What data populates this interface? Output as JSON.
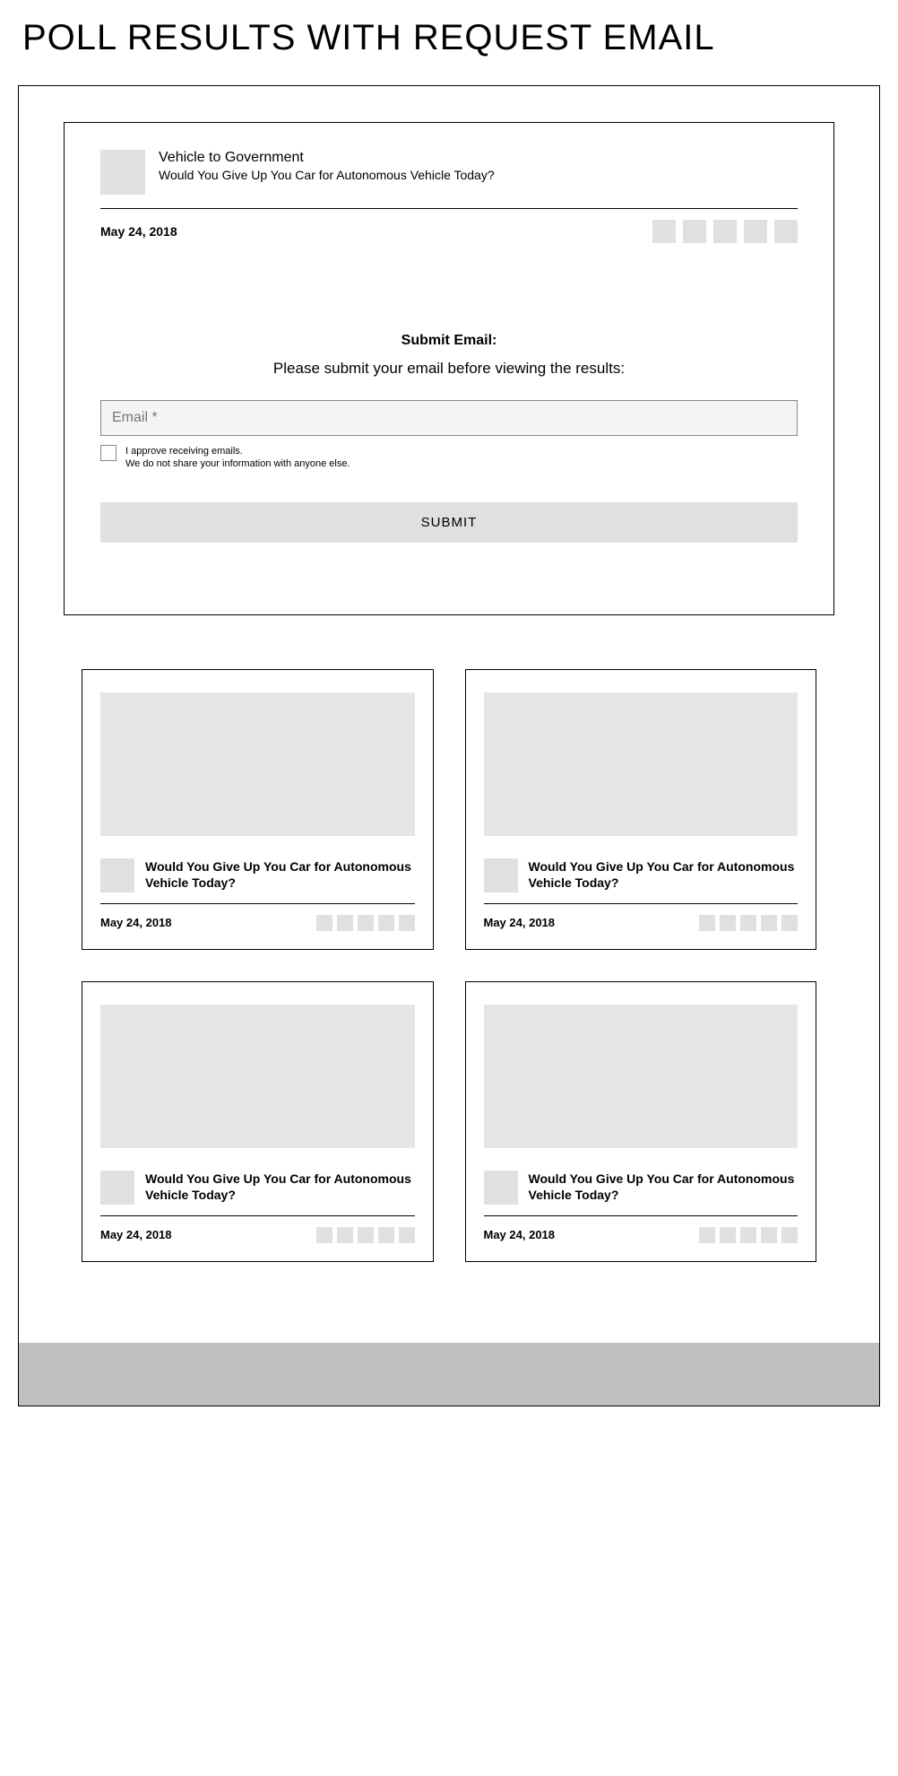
{
  "page_title": "POLL RESULTS WITH REQUEST EMAIL",
  "main": {
    "site_name": "Vehicle to Government",
    "question": "Would You Give Up You Car for Autonomous Vehicle Today?",
    "date": "May 24, 2018",
    "email": {
      "heading": "Submit Email:",
      "description": "Please submit your email before viewing the results:",
      "placeholder": "Email *",
      "consent_line1": "I approve receiving emails.",
      "consent_line2": "We do not share your information with anyone else.",
      "submit_label": "SUBMIT"
    }
  },
  "related": [
    {
      "title": "Would You Give Up You Car for Autonomous Vehicle Today?",
      "date": "May 24, 2018"
    },
    {
      "title": "Would You Give Up You Car for Autonomous Vehicle Today?",
      "date": "May 24, 2018"
    },
    {
      "title": "Would You Give Up You Car for Autonomous Vehicle Today?",
      "date": "May 24, 2018"
    },
    {
      "title": "Would You Give Up You Car for Autonomous Vehicle Today?",
      "date": "May 24, 2018"
    }
  ]
}
